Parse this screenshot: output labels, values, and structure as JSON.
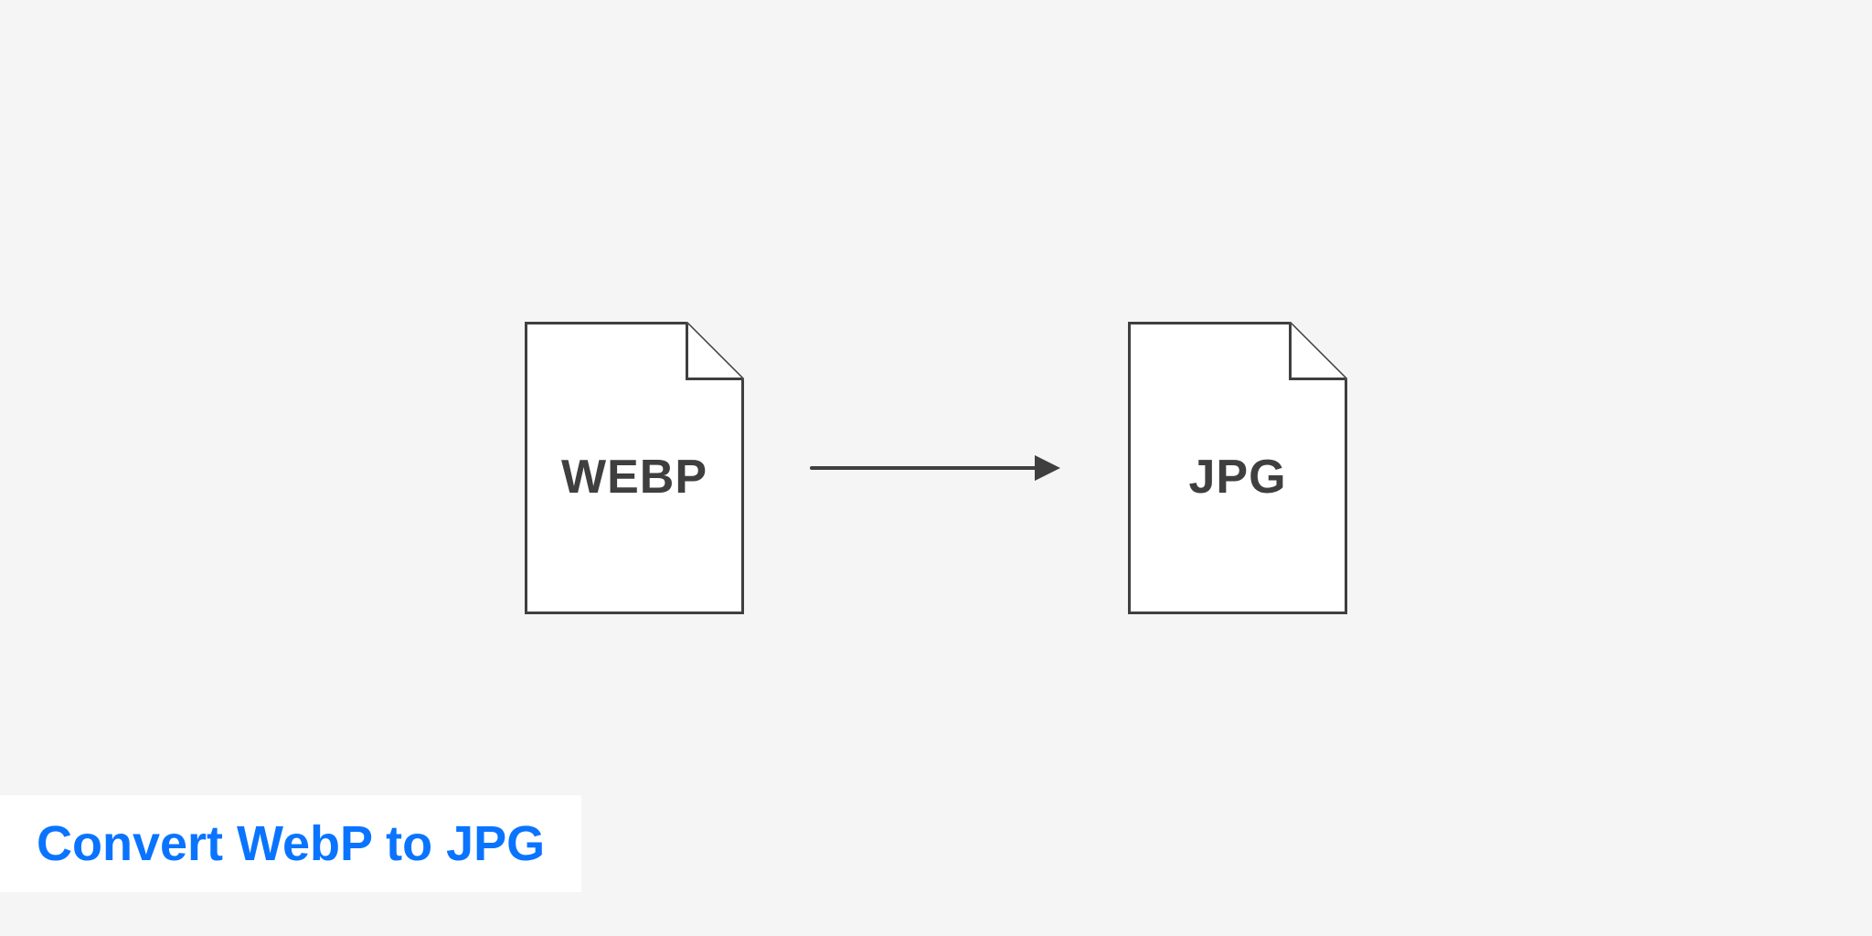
{
  "source_format_label": "WEBP",
  "target_format_label": "JPG",
  "caption": "Convert WebP to JPG",
  "colors": {
    "page_background": "#f5f5f5",
    "file_background": "#ffffff",
    "stroke": "#3f3f3f",
    "caption_background": "#ffffff",
    "caption_text": "#0a74ff"
  },
  "icons": {
    "source_file": "file-icon",
    "target_file": "file-icon",
    "arrow": "arrow-right-icon"
  }
}
